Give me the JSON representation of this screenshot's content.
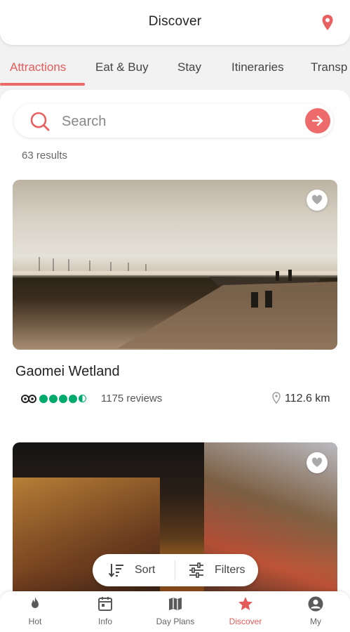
{
  "header": {
    "title": "Discover",
    "location_icon": "location-pin-icon"
  },
  "tabs": [
    {
      "label": "Attractions",
      "active": true
    },
    {
      "label": "Eat & Buy",
      "active": false
    },
    {
      "label": "Stay",
      "active": false
    },
    {
      "label": "Itineraries",
      "active": false
    },
    {
      "label": "Transp",
      "active": false
    }
  ],
  "search": {
    "placeholder": "Search",
    "value": ""
  },
  "results_count": "63 results",
  "cards": [
    {
      "title": "Gaomei Wetland",
      "rating": 4.5,
      "reviews": "1175 reviews",
      "distance": "112.6 km"
    },
    {
      "title": "",
      "rating": null,
      "reviews": "",
      "distance": ""
    }
  ],
  "sortbar": {
    "sort_label": "Sort",
    "filter_label": "Filters"
  },
  "bottom_nav": [
    {
      "label": "Hot",
      "icon": "flame-icon",
      "active": false
    },
    {
      "label": "Info",
      "icon": "calendar-icon",
      "active": false
    },
    {
      "label": "Day Plans",
      "icon": "map-icon",
      "active": false
    },
    {
      "label": "Discover",
      "icon": "star-icon",
      "active": true
    },
    {
      "label": "My",
      "icon": "account-icon",
      "active": false
    }
  ],
  "colors": {
    "accent": "#e45b5b",
    "rating_green": "#00aa6c"
  }
}
